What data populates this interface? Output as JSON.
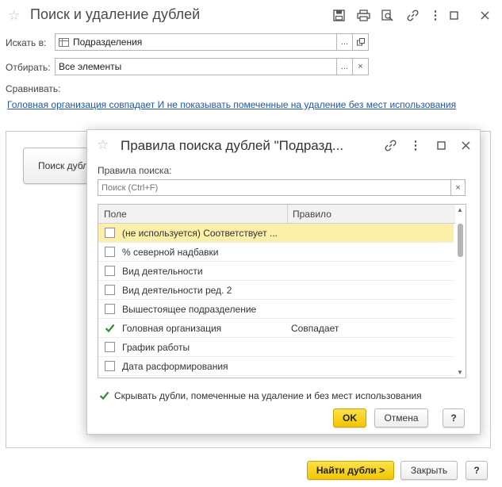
{
  "window": {
    "title": "Поиск и удаление дублей"
  },
  "form": {
    "search_in_label": "Искать в:",
    "search_in_value": "Подразделения",
    "filter_label": "Отбирать:",
    "filter_value": "Все элементы",
    "compare_label": "Сравнивать:",
    "compare_link": "Головная организация совпадает И не показывать помеченные на удаление без мест использования",
    "bg_button_label": "Поиск дубл"
  },
  "footer": {
    "find_label": "Найти дубли >",
    "close_label": "Закрыть",
    "help_label": "?"
  },
  "dialog": {
    "title": "Правила поиска дублей \"Подразд...",
    "rules_label": "Правила поиска:",
    "search_placeholder": "Поиск (Ctrl+F)",
    "col_field": "Поле",
    "col_rule": "Правило",
    "rows": [
      {
        "field": "(не используется) Соответствует ...",
        "rule": "",
        "checked": false,
        "selected": true
      },
      {
        "field": "% северной надбавки",
        "rule": "",
        "checked": false,
        "selected": false
      },
      {
        "field": "Вид деятельности",
        "rule": "",
        "checked": false,
        "selected": false
      },
      {
        "field": "Вид деятельности ред. 2",
        "rule": "",
        "checked": false,
        "selected": false
      },
      {
        "field": "Вышестоящее подразделение",
        "rule": "",
        "checked": false,
        "selected": false
      },
      {
        "field": "Головная организация",
        "rule": "Совпадает",
        "checked": true,
        "selected": false
      },
      {
        "field": "График работы",
        "rule": "",
        "checked": false,
        "selected": false
      },
      {
        "field": "Дата расформирования",
        "rule": "",
        "checked": false,
        "selected": false
      }
    ],
    "hide_label": "Скрывать дубли, помеченные на удаление и без мест использования",
    "hide_checked": true,
    "ok_label": "OK",
    "cancel_label": "Отмена",
    "help_label": "?"
  },
  "colors": {
    "accent_yellow": "#f2c500",
    "selected_row": "#fbefaa",
    "link": "#2056a8",
    "check_green": "#2f8f2f"
  }
}
